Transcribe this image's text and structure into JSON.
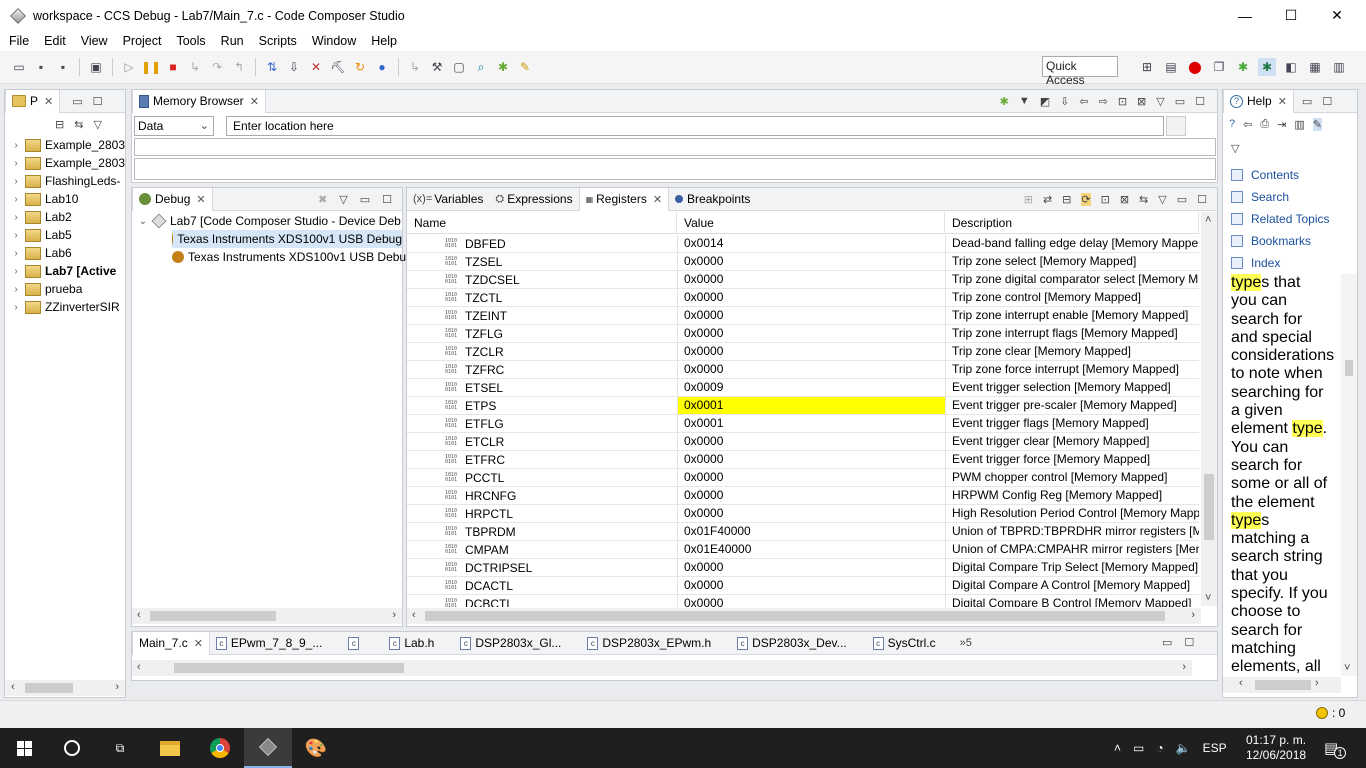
{
  "window": {
    "title": "workspace - CCS Debug - Lab7/Main_7.c - Code Composer Studio",
    "minimize": "—",
    "maximize": "☐",
    "close": "✕"
  },
  "menu": [
    "File",
    "Edit",
    "View",
    "Project",
    "Tools",
    "Run",
    "Scripts",
    "Window",
    "Help"
  ],
  "toolbar": {
    "quick_access": "Quick Access"
  },
  "project_explorer": {
    "tab_label": "P",
    "items": [
      {
        "label": "Example_2803",
        "bold": false
      },
      {
        "label": "Example_2803",
        "bold": false
      },
      {
        "label": "FlashingLeds-",
        "bold": false
      },
      {
        "label": "Lab10",
        "bold": false
      },
      {
        "label": "Lab2",
        "bold": false
      },
      {
        "label": "Lab5",
        "bold": false
      },
      {
        "label": "Lab6",
        "bold": false
      },
      {
        "label": "Lab7  [Active",
        "bold": true
      },
      {
        "label": "prueba",
        "bold": false
      },
      {
        "label": "ZZinverterSIR",
        "bold": false
      }
    ]
  },
  "memory_browser": {
    "tab_label": "Memory Browser",
    "page_select": "Data",
    "location_placeholder": "Enter location here"
  },
  "debug": {
    "tab_label": "Debug",
    "root": "Lab7 [Code Composer Studio - Device Deb",
    "children": [
      "Texas Instruments XDS100v1 USB Debug",
      "Texas Instruments XDS100v1 USB Debug"
    ]
  },
  "registers_view": {
    "tabs": [
      "Variables",
      "Expressions",
      "Registers",
      "Breakpoints"
    ],
    "tab_prefix_variables": "(x)=",
    "columns": [
      "Name",
      "Value",
      "Description"
    ],
    "rows": [
      {
        "name": "DBFED",
        "value": "0x0014",
        "desc": "Dead-band falling edge delay [Memory Mappe",
        "highlight": false
      },
      {
        "name": "TZSEL",
        "value": "0x0000",
        "desc": "Trip zone select [Memory Mapped]",
        "highlight": false
      },
      {
        "name": "TZDCSEL",
        "value": "0x0000",
        "desc": "Trip zone digital comparator select [Memory M",
        "highlight": false
      },
      {
        "name": "TZCTL",
        "value": "0x0000",
        "desc": "Trip zone control [Memory Mapped]",
        "highlight": false
      },
      {
        "name": "TZEINT",
        "value": "0x0000",
        "desc": "Trip zone interrupt enable [Memory Mapped]",
        "highlight": false
      },
      {
        "name": "TZFLG",
        "value": "0x0000",
        "desc": "Trip zone interrupt flags [Memory Mapped]",
        "highlight": false
      },
      {
        "name": "TZCLR",
        "value": "0x0000",
        "desc": "Trip zone clear [Memory Mapped]",
        "highlight": false
      },
      {
        "name": "TZFRC",
        "value": "0x0000",
        "desc": "Trip zone force interrupt [Memory Mapped]",
        "highlight": false
      },
      {
        "name": "ETSEL",
        "value": "0x0009",
        "desc": "Event trigger selection [Memory Mapped]",
        "highlight": false
      },
      {
        "name": "ETPS",
        "value": "0x0001",
        "desc": "Event trigger pre-scaler [Memory Mapped]",
        "highlight": true
      },
      {
        "name": "ETFLG",
        "value": "0x0001",
        "desc": "Event trigger flags [Memory Mapped]",
        "highlight": false
      },
      {
        "name": "ETCLR",
        "value": "0x0000",
        "desc": "Event trigger clear [Memory Mapped]",
        "highlight": false
      },
      {
        "name": "ETFRC",
        "value": "0x0000",
        "desc": "Event trigger force [Memory Mapped]",
        "highlight": false
      },
      {
        "name": "PCCTL",
        "value": "0x0000",
        "desc": "PWM chopper control [Memory Mapped]",
        "highlight": false
      },
      {
        "name": "HRCNFG",
        "value": "0x0000",
        "desc": "HRPWM Config Reg [Memory Mapped]",
        "highlight": false
      },
      {
        "name": "HRPCTL",
        "value": "0x0000",
        "desc": "High Resolution Period Control [Memory Mapp",
        "highlight": false
      },
      {
        "name": "TBPRDM",
        "value": "0x01F40000",
        "desc": "Union of TBPRD:TBPRDHR mirror registers [Me",
        "highlight": false
      },
      {
        "name": "CMPAM",
        "value": "0x01E40000",
        "desc": "Union of CMPA:CMPAHR mirror registers [Men",
        "highlight": false
      },
      {
        "name": "DCTRIPSEL",
        "value": "0x0000",
        "desc": "Digital Compare Trip Select [Memory Mapped]",
        "highlight": false
      },
      {
        "name": "DCACTL",
        "value": "0x0000",
        "desc": "Digital Compare A Control [Memory Mapped]",
        "highlight": false
      },
      {
        "name": "DCBCTL",
        "value": "0x0000",
        "desc": "Digital Compare B Control [Memory Mapped]",
        "highlight": false
      }
    ]
  },
  "editor_tabs": [
    {
      "label": "Main_7.c",
      "active": true
    },
    {
      "label": "EPwm_7_8_9_...",
      "active": false
    },
    {
      "label": "",
      "active": false
    },
    {
      "label": "Lab.h",
      "active": false
    },
    {
      "label": "DSP2803x_Gl...",
      "active": false
    },
    {
      "label": "DSP2803x_EPwm.h",
      "active": false
    },
    {
      "label": "DSP2803x_Dev...",
      "active": false
    },
    {
      "label": "SysCtrl.c",
      "active": false
    }
  ],
  "editor_overflow": "»5",
  "help": {
    "tab_label": "Help",
    "links": [
      "Contents",
      "Search",
      "Related Topics",
      "Bookmarks",
      "Index"
    ],
    "text_lines": [
      [
        {
          "t": "type",
          "hl": true
        },
        {
          "t": "s that",
          "hl": false
        }
      ],
      [
        {
          "t": "you can",
          "hl": false
        }
      ],
      [
        {
          "t": "search for",
          "hl": false
        }
      ],
      [
        {
          "t": "and special",
          "hl": false
        }
      ],
      [
        {
          "t": "considerations",
          "hl": false
        }
      ],
      [
        {
          "t": "to note when",
          "hl": false
        }
      ],
      [
        {
          "t": "searching for",
          "hl": false
        }
      ],
      [
        {
          "t": "a given",
          "hl": false
        }
      ],
      [
        {
          "t": "element ",
          "hl": false
        },
        {
          "t": "type",
          "hl": true
        },
        {
          "t": ".",
          "hl": false
        }
      ],
      [
        {
          "t": "You can",
          "hl": false
        }
      ],
      [
        {
          "t": "search for",
          "hl": false
        }
      ],
      [
        {
          "t": "some or all of",
          "hl": false
        }
      ],
      [
        {
          "t": "the element",
          "hl": false
        }
      ],
      [
        {
          "t": "type",
          "hl": true
        },
        {
          "t": "s",
          "hl": false
        }
      ],
      [
        {
          "t": "matching a",
          "hl": false
        }
      ],
      [
        {
          "t": "search string",
          "hl": false
        }
      ],
      [
        {
          "t": "that you",
          "hl": false
        }
      ],
      [
        {
          "t": "specify. If you",
          "hl": false
        }
      ],
      [
        {
          "t": "choose to",
          "hl": false
        }
      ],
      [
        {
          "t": "search for",
          "hl": false
        }
      ],
      [
        {
          "t": "matching",
          "hl": false
        }
      ],
      [
        {
          "t": "elements, all",
          "hl": false
        }
      ]
    ]
  },
  "status": {
    "heap": ": 0"
  },
  "taskbar": {
    "time": "01:17 p. m.",
    "date": "12/06/2018",
    "lang": "ESP",
    "notifications": "1"
  }
}
